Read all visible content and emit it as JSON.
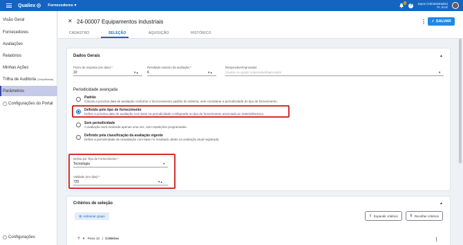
{
  "app": {
    "brand": "Qualiex",
    "module": "Fornecedores"
  },
  "topbar": {
    "notifications": "0",
    "help_symbol": "?",
    "user_name": "Joyce (Administrador)",
    "user_org": "FI, EAX"
  },
  "sidebar": {
    "items": [
      {
        "label": "Visão Geral"
      },
      {
        "label": "Fornecedores"
      },
      {
        "label": "Avaliações"
      },
      {
        "label": "Relatórios"
      },
      {
        "label": "Minhas Ações"
      },
      {
        "label": "Trilha de Auditoria",
        "tag": "(Simplificada)"
      },
      {
        "label": "Parâmetros"
      },
      {
        "label": "Configurações do Portal"
      }
    ],
    "footer": "Configurações"
  },
  "header": {
    "title": "24-00007 Equipamentos industriais",
    "save_label": "SALVAR",
    "tabs": [
      "CADASTRO",
      "SELEÇÃO",
      "AQUISIÇÃO",
      "HISTÓRICO"
    ],
    "active_tab": "SELEÇÃO"
  },
  "dados_gerais": {
    "title": "Dados Gerais",
    "prazo": {
      "label": "Prazo de resposta (em dias) *",
      "value": "10"
    },
    "resultado": {
      "label": "Resultado máximo da avaliação *",
      "value": "6"
    },
    "responsavel": {
      "label": "Responsável/Aprovador",
      "placeholder": "Usuário ou grupo responsável/aprovador"
    }
  },
  "periodicidade": {
    "title": "Periodicidade avançada",
    "options": [
      {
        "title": "Padrão",
        "desc": "Calcula a próxima data de avaliação conforme o funcionamento padrão do sistema, sem considerar a periodicidade do tipo de fornecimento.",
        "checked": false
      },
      {
        "title": "Definido pelo tipo de fornecimento",
        "desc": "Define a próxima data de avaliação com base na periodicidade configurada no tipo de fornecimento associado ao material/serviço.",
        "checked": true
      },
      {
        "title": "Sem periodicidade",
        "desc": "A avaliação será realizada apenas uma vez, sem repetições programadas.",
        "checked": false
      },
      {
        "title": "Definido pela classificação da avaliação vigente",
        "desc": "Define a periodicidade de reavaliação com base no resultado obtido na avaliação atual registrada.",
        "checked": false
      }
    ],
    "tipo_fornecimento": {
      "label": "Defina por Tipo de Fornecimento *",
      "value": "Tecnologia"
    },
    "validade": {
      "label": "Validade (em dias) *",
      "value": "720"
    }
  },
  "criterios": {
    "title": "Critérios de seleção",
    "add_group": "Adicionar grupo",
    "expand_all": "Expandir critérios",
    "collapse_all": "Recolher critérios",
    "group": {
      "weight": "Peso 10",
      "label": "Critérios"
    }
  },
  "colors": {
    "primary": "#1565c0",
    "highlight": "#d32f2f",
    "active_side": "#c5cbe8"
  }
}
